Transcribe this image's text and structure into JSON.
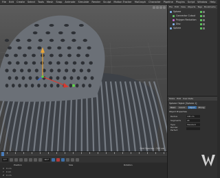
{
  "menubar": {
    "items": [
      "File",
      "Edit",
      "Create",
      "Select",
      "Tools",
      "Mesh",
      "Snap",
      "Animate",
      "Simulate",
      "Render",
      "Sculpt",
      "Motion Tracker",
      "MoGraph",
      "Character",
      "Pipeline",
      "Plugins",
      "Script",
      "Window",
      "Help"
    ]
  },
  "viewport": {
    "grid_spacing": "Grid Spacing : 100 cm",
    "colors": {
      "mesh": "#6b7077",
      "mesh_dark": "#3d4147",
      "axis_y": "#e8a63a",
      "axis_x": "#d83a2f",
      "axis_z": "#2f66e0",
      "axis_green": "#5fcf48"
    }
  },
  "timeline": {
    "start_field": "0 F",
    "end_field": "90 F",
    "coords": {
      "headers": [
        "Position",
        "Size",
        "Rotation"
      ],
      "rows": [
        "X",
        "Y",
        "Z"
      ],
      "values": [
        "0 cm",
        "0 cm",
        "0 cm"
      ]
    }
  },
  "object_manager": {
    "tabs": [
      "File",
      "Edit",
      "View",
      "Objects",
      "Tags",
      "Bookmarks"
    ],
    "objects": [
      {
        "name": "Sphere",
        "color": "#7fb0e8"
      },
      {
        "name": "Connector Cutout",
        "color": "#67c46a"
      },
      {
        "name": "Polygon Reduction",
        "color": "#c56fd2"
      },
      {
        "name": "Disc",
        "color": "#7fb0e8"
      },
      {
        "name": "Sphere",
        "color": "#7fb0e8"
      }
    ]
  },
  "attribute_manager": {
    "tabs": [
      "Mode",
      "Edit",
      "User Data"
    ],
    "title": "Sphere Object [Sphere.1]",
    "subtabs": [
      "Basic",
      "Coord.",
      "Object",
      "Phong"
    ],
    "active_subtab": "Object",
    "section": "Object Properties",
    "props": [
      {
        "label": "Radius",
        "value": "100 cm"
      },
      {
        "label": "Segments",
        "value": "24"
      },
      {
        "label": "Type",
        "value": "Standard"
      },
      {
        "label": "Render Perfect",
        "value": ""
      }
    ]
  }
}
